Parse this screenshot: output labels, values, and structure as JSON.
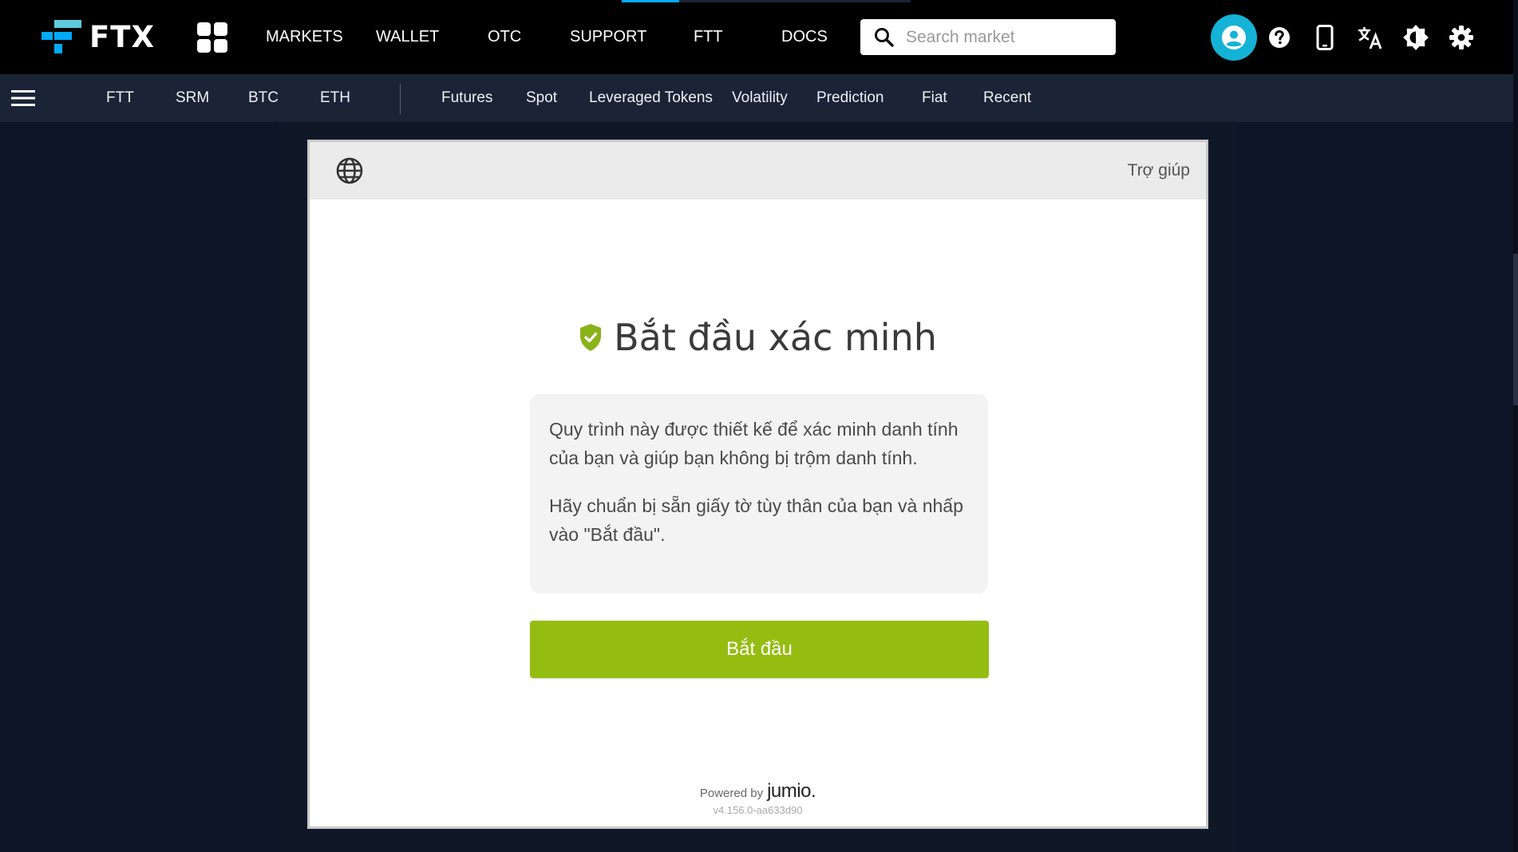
{
  "brand": {
    "name": "FTX",
    "accent": "#02a9f4"
  },
  "topnav": {
    "items": [
      "MARKETS",
      "WALLET",
      "OTC",
      "SUPPORT",
      "FTT",
      "DOCS"
    ]
  },
  "search": {
    "placeholder": "Search market"
  },
  "top_icons": [
    "account-icon",
    "help-icon",
    "mobile-icon",
    "translate-icon",
    "theme-icon",
    "settings-icon"
  ],
  "subnav": {
    "coins": [
      "FTT",
      "SRM",
      "BTC",
      "ETH"
    ],
    "categories": [
      "Futures",
      "Spot",
      "Leveraged Tokens",
      "Volatility",
      "Prediction",
      "Fiat",
      "Recent"
    ]
  },
  "verification": {
    "help_link": "Trợ giúp",
    "title": "Bắt đầu xác minh",
    "paragraph_1": "Quy trình này được thiết kế để xác minh danh tính của bạn và giúp bạn không bị trộm danh tính.",
    "paragraph_2": "Hãy chuẩn bị sẵn giấy tờ tùy thân của bạn và nhấp vào \"Bắt đầu\".",
    "start_button": "Bắt đầu",
    "powered_by": "Powered by",
    "powered_brand": "jumio.",
    "version": "v4.156.0-aa633d90",
    "button_color": "#95bc10",
    "shield_color": "#8ab31a"
  }
}
